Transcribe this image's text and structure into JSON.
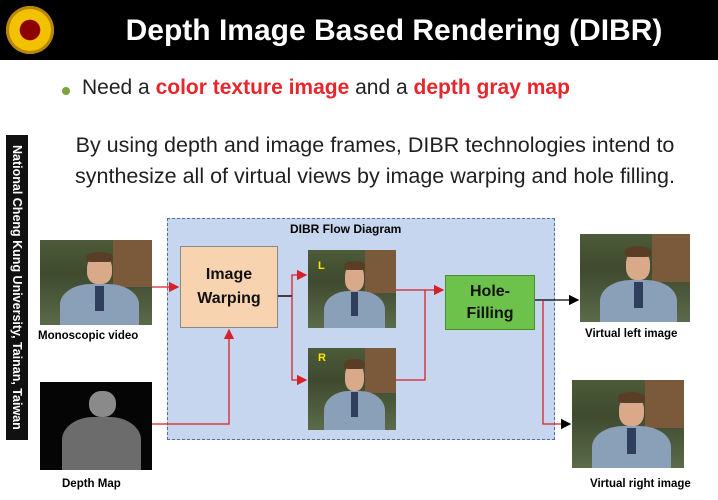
{
  "header": {
    "title": "Depth Image Based Rendering (DIBR)"
  },
  "bullet": {
    "prefix": "Need a ",
    "term1": "color texture image",
    "middle": " and a ",
    "term2": "depth gray map"
  },
  "paragraph": "By using depth and image frames, DIBR technologies intend to synthesize all of virtual views by image warping and hole filling.",
  "sidebar_label": "National Cheng Kung University, Tainan, Taiwan",
  "diagram": {
    "title": "DIBR Flow Diagram",
    "warp_box": "Image Warping",
    "fill_box": "Hole-Filling",
    "left_label": "L",
    "right_label": "R"
  },
  "captions": {
    "mono": "Monoscopic video",
    "depth": "Depth  Map",
    "virtual_left": "Virtual left image",
    "virtual_right": "Virtual right image"
  },
  "colors": {
    "title_bg": "#000000",
    "highlight": "#e8262b",
    "panel_bg": "#c6d6ee",
    "warp_box": "#f7d3b0",
    "fill_box": "#6cc24a",
    "arrow_red": "#d8202a",
    "arrow_black": "#000000"
  }
}
